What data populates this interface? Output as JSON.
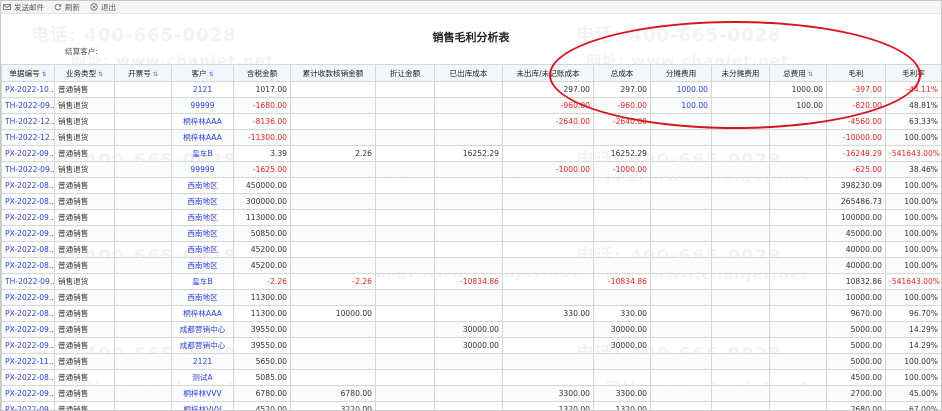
{
  "toolbar": {
    "send_email": "发送邮件",
    "refresh": "刷新",
    "exit": "退出"
  },
  "report": {
    "title": "销售毛利分析表",
    "filter_label": "结算客户:"
  },
  "watermark": {
    "phone": "电话: 400-665-0028",
    "url": "网址: www.chanjet.net"
  },
  "table": {
    "headers": [
      "单据编号",
      "业务类型",
      "开票号",
      "客户",
      "含税金额",
      "累计收款核销金额",
      "折让金额",
      "已出库成本",
      "未出库/未记账成本",
      "总成本",
      "分摊费用",
      "未分摊费用",
      "总费用",
      "毛利",
      "毛利率"
    ],
    "rows": [
      [
        "PX-2022-10...",
        "普通销售",
        "",
        "2121",
        "1017.00",
        "",
        "",
        "",
        "297.00",
        "297.00",
        "1000.00",
        "",
        "1000.00",
        "-397.00",
        "-44.11%"
      ],
      [
        "TH-2022-09...",
        "销售退货",
        "",
        "99999",
        "-1680.00",
        "",
        "",
        "",
        "-960.00",
        "-960.00",
        "100.00",
        "",
        "100.00",
        "-820.00",
        "48.81%"
      ],
      [
        "TH-2022-12...",
        "销售退货",
        "",
        "桐梓林AAA",
        "-8136.00",
        "",
        "",
        "",
        "-2640.00",
        "-2640.00",
        "",
        "",
        "",
        "-4560.00",
        "63.33%"
      ],
      [
        "TH-2022-12...",
        "销售退货",
        "",
        "桐梓林AAA",
        "-11300.00",
        "",
        "",
        "",
        "",
        "",
        "",
        "",
        "",
        "-10000.00",
        "100.00%"
      ],
      [
        "PX-2022-09...",
        "普通销售",
        "",
        "玺车B",
        "3.39",
        "2.26",
        "",
        "16252.29",
        "",
        "16252.29",
        "",
        "",
        "",
        "-16249.29",
        "-541643.00%"
      ],
      [
        "TH-2022-09...",
        "销售退货",
        "",
        "99999",
        "-1625.00",
        "",
        "",
        "",
        "-1000.00",
        "-1000.00",
        "",
        "",
        "",
        "-625.00",
        "38.46%"
      ],
      [
        "PX-2022-08...",
        "普通销售",
        "",
        "西南地区",
        "450000.00",
        "",
        "",
        "",
        "",
        "",
        "",
        "",
        "",
        "398230.09",
        "100.00%"
      ],
      [
        "PX-2022-08...",
        "普通销售",
        "",
        "西南地区",
        "300000.00",
        "",
        "",
        "",
        "",
        "",
        "",
        "",
        "",
        "265486.73",
        "100.00%"
      ],
      [
        "PX-2022-09...",
        "普通销售",
        "",
        "西南地区",
        "113000.00",
        "",
        "",
        "",
        "",
        "",
        "",
        "",
        "",
        "100000.00",
        "100.00%"
      ],
      [
        "PX-2022-09...",
        "普通销售",
        "",
        "西南地区",
        "50850.00",
        "",
        "",
        "",
        "",
        "",
        "",
        "",
        "",
        "45000.00",
        "100.00%"
      ],
      [
        "PX-2022-08...",
        "普通销售",
        "",
        "西南地区",
        "45200.00",
        "",
        "",
        "",
        "",
        "",
        "",
        "",
        "",
        "40000.00",
        "100.00%"
      ],
      [
        "PX-2022-08...",
        "普通销售",
        "",
        "西南地区",
        "45200.00",
        "",
        "",
        "",
        "",
        "",
        "",
        "",
        "",
        "40000.00",
        "100.00%"
      ],
      [
        "TH-2022-09...",
        "销售退货",
        "",
        "玺车B",
        "-2.26",
        "-2.26",
        "",
        "-10834.86",
        "",
        "-10834.86",
        "",
        "",
        "",
        "10832.86",
        "-541643.00%"
      ],
      [
        "PX-2022-09...",
        "普通销售",
        "",
        "西南地区",
        "11300.00",
        "",
        "",
        "",
        "",
        "",
        "",
        "",
        "",
        "10000.00",
        "100.00%"
      ],
      [
        "PX-2022-08...",
        "普通销售",
        "",
        "桐梓林AAA",
        "11300.00",
        "10000.00",
        "",
        "",
        "330.00",
        "330.00",
        "",
        "",
        "",
        "9670.00",
        "96.70%"
      ],
      [
        "PX-2022-09...",
        "普通销售",
        "",
        "成都营销中心",
        "39550.00",
        "",
        "",
        "30000.00",
        "",
        "30000.00",
        "",
        "",
        "",
        "5000.00",
        "14.29%"
      ],
      [
        "PX-2022-09...",
        "普通销售",
        "",
        "成都营销中心",
        "39550.00",
        "",
        "",
        "30000.00",
        "",
        "30000.00",
        "",
        "",
        "",
        "5000.00",
        "14.29%"
      ],
      [
        "PX-2022-11...",
        "普通销售",
        "",
        "2121",
        "5650.00",
        "",
        "",
        "",
        "",
        "",
        "",
        "",
        "",
        "5000.00",
        "100.00%"
      ],
      [
        "PX-2022-08...",
        "普通销售",
        "",
        "测试A",
        "5085.00",
        "",
        "",
        "",
        "",
        "",
        "",
        "",
        "",
        "4500.00",
        "100.00%"
      ],
      [
        "PX-2022-09...",
        "普通销售",
        "",
        "桐梓林VVV",
        "6780.00",
        "6780.00",
        "",
        "",
        "3300.00",
        "3300.00",
        "",
        "",
        "",
        "2700.00",
        "45.00%"
      ],
      [
        "PX-2022-09...",
        "普通销售",
        "",
        "桐梓林VVV",
        "4520.00",
        "3220.00",
        "",
        "",
        "1320.00",
        "1320.00",
        "",
        "",
        "",
        "2680.00",
        "67.00%"
      ]
    ]
  },
  "colors": {
    "negative": "#e02424",
    "link": "#2b3fd6",
    "annotation_circle": "#d8141c",
    "header_bg": "#f3f6fb"
  }
}
